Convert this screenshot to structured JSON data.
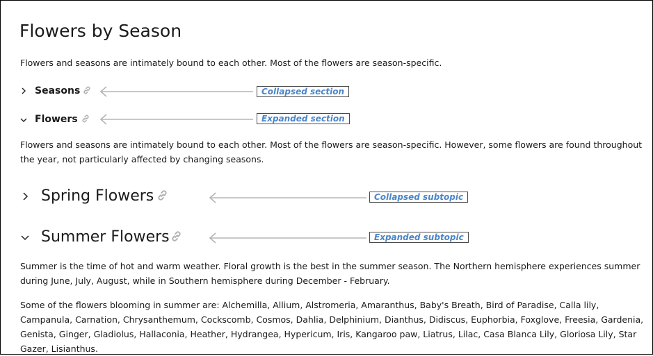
{
  "page": {
    "title": "Flowers by Season",
    "intro": "Flowers and seasons are intimately bound to each other. Most of the flowers are season-specific."
  },
  "sections": [
    {
      "label": "Seasons",
      "state": "collapsed",
      "callout": "Collapsed section"
    },
    {
      "label": "Flowers",
      "state": "expanded",
      "callout": "Expanded section"
    }
  ],
  "flowers_text": "Flowers and seasons are intimately bound to each other. Most of the flowers are season-specific. However, some flowers are found throughout the year, not particularly affected by changing seasons.",
  "subtopics": [
    {
      "label": "Spring Flowers",
      "state": "collapsed",
      "callout": "Collapsed subtopic"
    },
    {
      "label": "Summer Flowers",
      "state": "expanded",
      "callout": "Expanded subtopic"
    }
  ],
  "summer": {
    "para1": "Summer is the time of hot and warm weather. Floral growth is the best in the summer season. The Northern hemisphere experiences summer during June, July, August, while in Southern hemisphere during December - February.",
    "para2": "Some of the flowers blooming in summer are: Alchemilla, Allium, Alstromeria, Amaranthus, Baby's Breath, Bird of Paradise, Calla lily, Campanula, Carnation, Chrysanthemum, Cockscomb, Cosmos, Dahlia, Delphinium, Dianthus, Didiscus, Euphorbia, Foxglove, Freesia, Gardenia, Genista, Ginger, Gladiolus, Hallaconia, Heather, Hydrangea, Hypericum, Iris, Kangaroo paw, Liatrus, Lilac, Casa Blanca Lily, Gloriosa Lily, Star Gazer, Lisianthus."
  },
  "icons": {
    "chevron_right": "chevron-right-icon",
    "chevron_down": "chevron-down-icon",
    "link": "link-icon",
    "arrow": "arrow-left-icon"
  },
  "colors": {
    "callout_text": "#4a86c8",
    "arrow": "#b5b5b5",
    "link_icon": "#b0b0b0"
  }
}
